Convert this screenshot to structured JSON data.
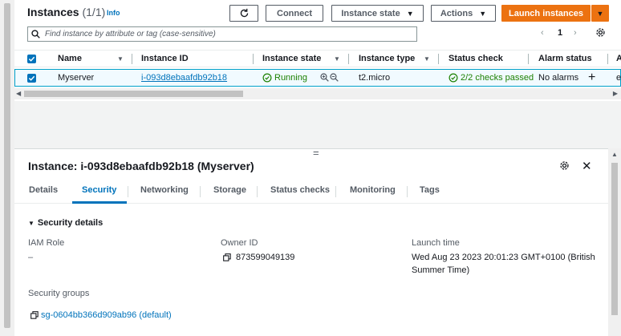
{
  "header": {
    "title": "Instances",
    "count": "(1/1)",
    "info": "Info"
  },
  "toolbar": {
    "connect": "Connect",
    "instance_state": "Instance state",
    "actions": "Actions",
    "launch": "Launch instances"
  },
  "search": {
    "placeholder": "Find instance by attribute or tag (case-sensitive)"
  },
  "pager": {
    "page": "1"
  },
  "table": {
    "columns": [
      "Name",
      "Instance ID",
      "Instance state",
      "Instance type",
      "Status check",
      "Alarm status",
      "A"
    ],
    "row": {
      "name": "Myserver",
      "instance_id": "i-093d8ebaafdb92b18",
      "state": "Running",
      "type": "t2.micro",
      "status_check": "2/2 checks passed",
      "alarm": "No alarms",
      "extra": "e"
    }
  },
  "detail": {
    "handle": "=",
    "title": "Instance: i-093d8ebaafdb92b18 (Myserver)",
    "tabs": [
      "Details",
      "Security",
      "Networking",
      "Storage",
      "Status checks",
      "Monitoring",
      "Tags"
    ],
    "active_tab": "Security",
    "section": "Security details",
    "iam_role_label": "IAM Role",
    "iam_role_value": "–",
    "owner_label": "Owner ID",
    "owner_value": "873599049139",
    "launch_label": "Launch time",
    "launch_value": "Wed Aug 23 2023 20:01:23 GMT+0100 (British Summer Time)",
    "sg_label": "Security groups",
    "sg_value": "sg-0604bb366d909ab96 (default)"
  },
  "colors": {
    "accent": "#0073bb",
    "orange": "#ec7211",
    "success": "#1d8102"
  }
}
